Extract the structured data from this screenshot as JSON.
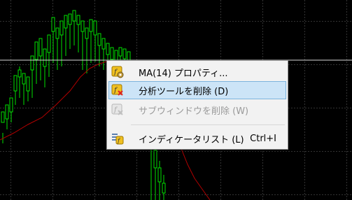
{
  "menu": {
    "items": [
      {
        "label": "MA(14) プロパティ...",
        "icon": "properties-icon",
        "state": "normal"
      },
      {
        "label": "分析ツールを削除 (D)",
        "icon": "delete-indicator-icon",
        "state": "selected"
      },
      {
        "label": "サブウィンドウを削除 (W)",
        "icon": "delete-subwindow-icon",
        "state": "disabled"
      },
      {
        "label": "インディケータリスト (L)",
        "shortcut": "Ctrl+I",
        "icon": "indicator-list-icon",
        "state": "normal"
      }
    ]
  },
  "colors": {
    "chart_bg": "#000000",
    "candle_green": "#00e000",
    "ma_line": "#b00000",
    "grid": "#333333",
    "menu_bg": "#f2f2f2",
    "selected_bg": "#cce4f7"
  }
}
